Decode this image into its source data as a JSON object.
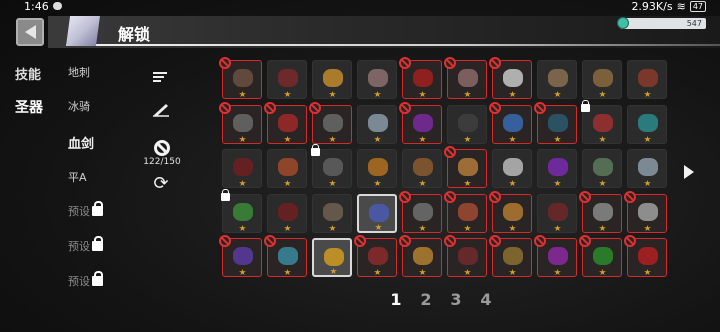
{
  "status": {
    "time": "1:46",
    "net_speed": "2.93K/s",
    "battery": "47"
  },
  "header": {
    "title": "解锁",
    "gems": "547"
  },
  "nav": {
    "skills": "技能",
    "artifacts": "圣器"
  },
  "subnav": [
    {
      "label": "地刺"
    },
    {
      "label": "冰骑"
    },
    {
      "label": "血剑"
    },
    {
      "label": "平A"
    },
    {
      "label": "预设",
      "locked": true
    },
    {
      "label": "预设",
      "locked": true
    },
    {
      "label": "预设",
      "locked": true
    }
  ],
  "tools": {
    "count": "122/150"
  },
  "pages": [
    "1",
    "2",
    "3",
    "4"
  ],
  "grid": {
    "rows": [
      [
        {
          "b": 1,
          "c": "#6b5040"
        },
        {
          "b": 0,
          "c": "#7a2a2a"
        },
        {
          "b": 0,
          "c": "#c08a2a"
        },
        {
          "b": 0,
          "c": "#8c7070"
        },
        {
          "b": 1,
          "c": "#a02020"
        },
        {
          "b": 1,
          "c": "#8a6a6a"
        },
        {
          "b": 1,
          "c": "#c8c8c8"
        },
        {
          "b": 0,
          "c": "#8a7050"
        },
        {
          "b": 0,
          "c": "#8a6a40"
        },
        {
          "b": 0,
          "c": "#8a3a2a"
        }
      ],
      [
        {
          "b": 1,
          "c": "#6a6a6a"
        },
        {
          "b": 1,
          "c": "#a02828"
        },
        {
          "b": 1,
          "c": "#6a6a6a"
        },
        {
          "b": 0,
          "c": "#8a9aa8"
        },
        {
          "b": 1,
          "c": "#7a2aa0"
        },
        {
          "b": 0,
          "c": "#404040"
        },
        {
          "b": 1,
          "c": "#3a6ab0"
        },
        {
          "b": 1,
          "c": "#2a5a70"
        },
        {
          "b": 0,
          "l": 1,
          "c": "#a03030"
        },
        {
          "b": 0,
          "c": "#2a8a8a"
        }
      ],
      [
        {
          "b": 0,
          "c": "#702020"
        },
        {
          "b": 0,
          "c": "#a04a2a"
        },
        {
          "b": 0,
          "l": 1,
          "c": "#606060"
        },
        {
          "b": 0,
          "c": "#b07020"
        },
        {
          "b": 0,
          "c": "#8a5a30"
        },
        {
          "b": 1,
          "c": "#b07a3a"
        },
        {
          "b": 0,
          "c": "#bababa"
        },
        {
          "b": 0,
          "c": "#7a2ab0"
        },
        {
          "b": 0,
          "c": "#5a7a5a"
        },
        {
          "b": 0,
          "c": "#8a9aa8"
        }
      ],
      [
        {
          "b": 0,
          "l": 1,
          "c": "#3a8a3a"
        },
        {
          "b": 0,
          "c": "#702020"
        },
        {
          "b": 0,
          "c": "#706050"
        },
        {
          "b": 0,
          "s": 1,
          "c": "#4a5ab0"
        },
        {
          "b": 1,
          "c": "#707070"
        },
        {
          "b": 1,
          "c": "#a04a30"
        },
        {
          "b": 1,
          "c": "#b07a30"
        },
        {
          "b": 0,
          "c": "#702828"
        },
        {
          "b": 1,
          "c": "#8a8a8a"
        },
        {
          "b": 1,
          "c": "#a0a0a0"
        }
      ],
      [
        {
          "b": 1,
          "c": "#5a3aa0"
        },
        {
          "b": 1,
          "c": "#3a8aa0"
        },
        {
          "b": 0,
          "s": 1,
          "c": "#d09a20"
        },
        {
          "b": 1,
          "c": "#8a2a2a"
        },
        {
          "b": 1,
          "c": "#b08030"
        },
        {
          "b": 1,
          "c": "#702a2a"
        },
        {
          "b": 1,
          "c": "#8a7030"
        },
        {
          "b": 1,
          "c": "#8a2aa0"
        },
        {
          "b": 1,
          "c": "#2a8a2a"
        },
        {
          "b": 1,
          "c": "#b02020"
        }
      ]
    ]
  }
}
